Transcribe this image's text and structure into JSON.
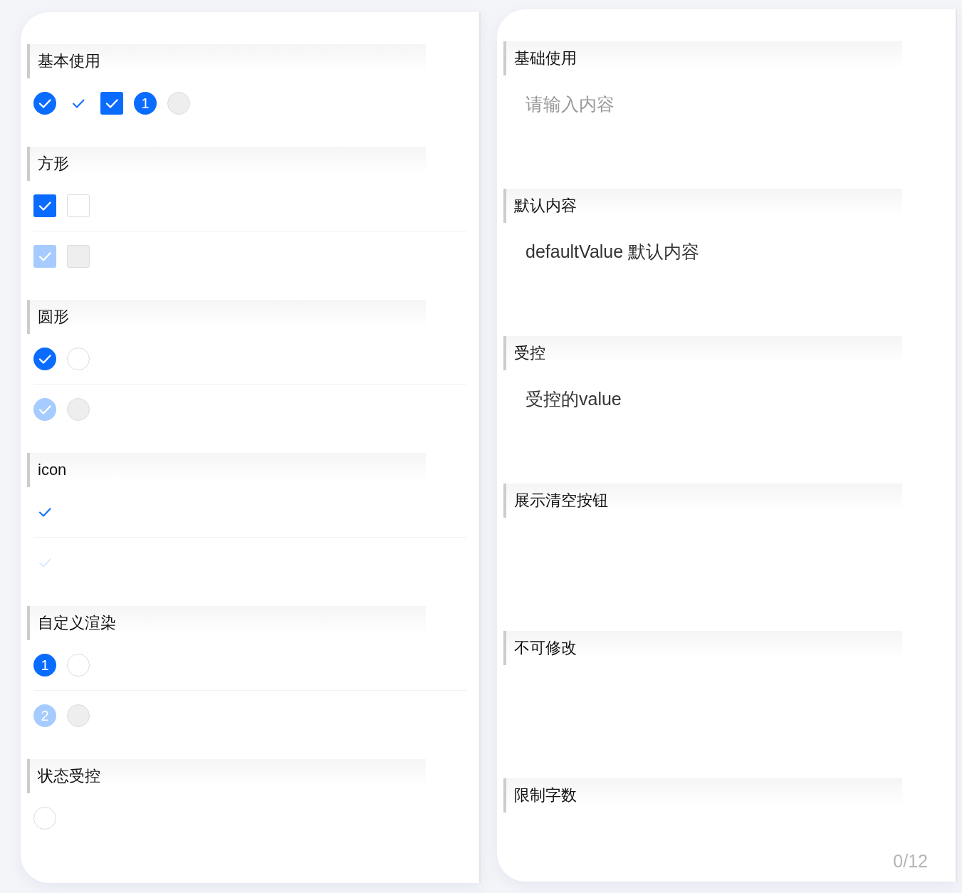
{
  "left": {
    "sections": [
      {
        "title": "基本使用",
        "rows": [
          {
            "items": [
              {
                "kind": "circle",
                "checked": true,
                "disabled": false
              },
              {
                "kind": "tick",
                "checked": true,
                "disabled": false
              },
              {
                "kind": "square",
                "checked": true,
                "disabled": false
              },
              {
                "kind": "number",
                "label": "1",
                "checked": true,
                "disabled": false
              },
              {
                "kind": "circle",
                "checked": false,
                "disabled": true
              }
            ]
          }
        ]
      },
      {
        "title": "方形",
        "rows": [
          {
            "items": [
              {
                "kind": "square",
                "checked": true,
                "disabled": false
              },
              {
                "kind": "square",
                "checked": false,
                "disabled": false
              }
            ]
          },
          {
            "items": [
              {
                "kind": "square",
                "checked": true,
                "disabled": true
              },
              {
                "kind": "square",
                "checked": false,
                "disabled": true
              }
            ]
          }
        ]
      },
      {
        "title": "圆形",
        "rows": [
          {
            "items": [
              {
                "kind": "circle",
                "checked": true,
                "disabled": false
              },
              {
                "kind": "circle",
                "checked": false,
                "disabled": false
              }
            ]
          },
          {
            "items": [
              {
                "kind": "circle",
                "checked": true,
                "disabled": true
              },
              {
                "kind": "circle",
                "checked": false,
                "disabled": true
              }
            ]
          }
        ]
      },
      {
        "title": "icon",
        "rows": [
          {
            "items": [
              {
                "kind": "tick",
                "checked": true,
                "disabled": false
              }
            ]
          },
          {
            "items": [
              {
                "kind": "tick",
                "checked": true,
                "disabled": true
              }
            ]
          }
        ]
      },
      {
        "title": "自定义渲染",
        "rows": [
          {
            "items": [
              {
                "kind": "number",
                "label": "1",
                "checked": true,
                "disabled": false
              },
              {
                "kind": "circle",
                "checked": false,
                "disabled": false
              }
            ]
          },
          {
            "items": [
              {
                "kind": "number",
                "label": "2",
                "checked": true,
                "disabled": true
              },
              {
                "kind": "circle",
                "checked": false,
                "disabled": true
              }
            ]
          }
        ]
      },
      {
        "title": "状态受控",
        "rows": [
          {
            "items": [
              {
                "kind": "circle",
                "checked": false,
                "disabled": false
              }
            ]
          }
        ]
      }
    ]
  },
  "right": {
    "sections": [
      {
        "title": "基础使用",
        "field": {
          "placeholder": "请输入内容"
        }
      },
      {
        "title": "默认内容",
        "field": {
          "value": "defaultValue 默认内容"
        }
      },
      {
        "title": "受控",
        "field": {
          "value": "受控的value"
        }
      },
      {
        "title": "展示清空按钮"
      },
      {
        "title": "不可修改"
      },
      {
        "title": "限制字数",
        "field": {
          "counter": "0/12"
        }
      }
    ]
  }
}
